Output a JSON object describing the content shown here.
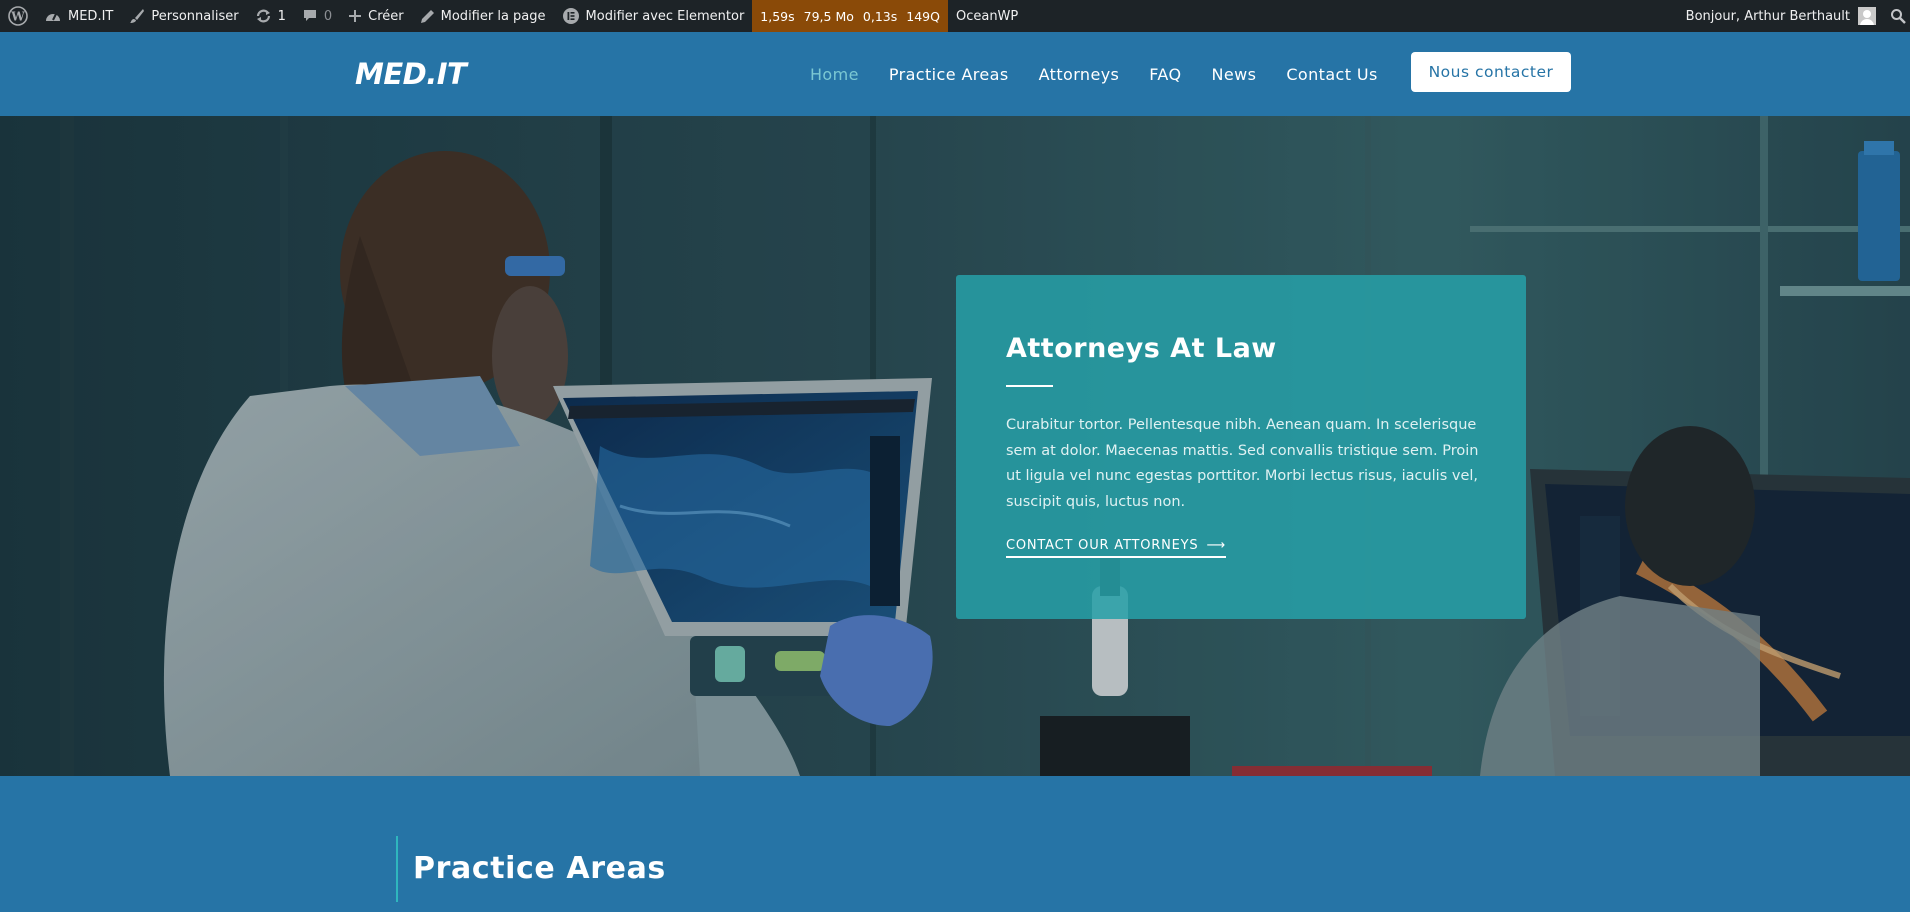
{
  "admin_bar": {
    "site_name": "MED.IT",
    "customize": "Personnaliser",
    "updates_count": "1",
    "comments_count": "0",
    "new": "Créer",
    "edit_page": "Modifier la page",
    "edit_elementor": "Modifier avec Elementor",
    "perf": {
      "time": "1,59s",
      "memory": "79,5 Mo",
      "query_time": "0,13s",
      "queries": "149Q"
    },
    "theme": "OceanWP",
    "greeting": "Bonjour, Arthur Berthault"
  },
  "header": {
    "logo": "MED.IT",
    "nav": [
      {
        "label": "Home",
        "active": true
      },
      {
        "label": "Practice Areas",
        "active": false
      },
      {
        "label": "Attorneys",
        "active": false
      },
      {
        "label": "FAQ",
        "active": false
      },
      {
        "label": "News",
        "active": false
      },
      {
        "label": "Contact Us",
        "active": false
      }
    ],
    "cta": "Nous contacter"
  },
  "hero": {
    "title": "Attorneys At Law",
    "text": "Curabitur tortor. Pellentesque nibh. Aenean quam. In scelerisque sem at dolor. Maecenas mattis. Sed convallis tristique sem. Proin ut ligula vel nunc egestas porttitor. Morbi lectus risus, iaculis vel, suscipit quis, luctus non.",
    "link": "CONTACT OUR ATTORNEYS",
    "link_arrow": "⟶"
  },
  "practice": {
    "title": "Practice Areas"
  },
  "colors": {
    "admin_bar": "#1d2327",
    "brand_blue": "#2674a6",
    "teal_card": "#26a0a8",
    "nav_active": "#7bc8d3",
    "perf_orange": "#8a4a08"
  }
}
